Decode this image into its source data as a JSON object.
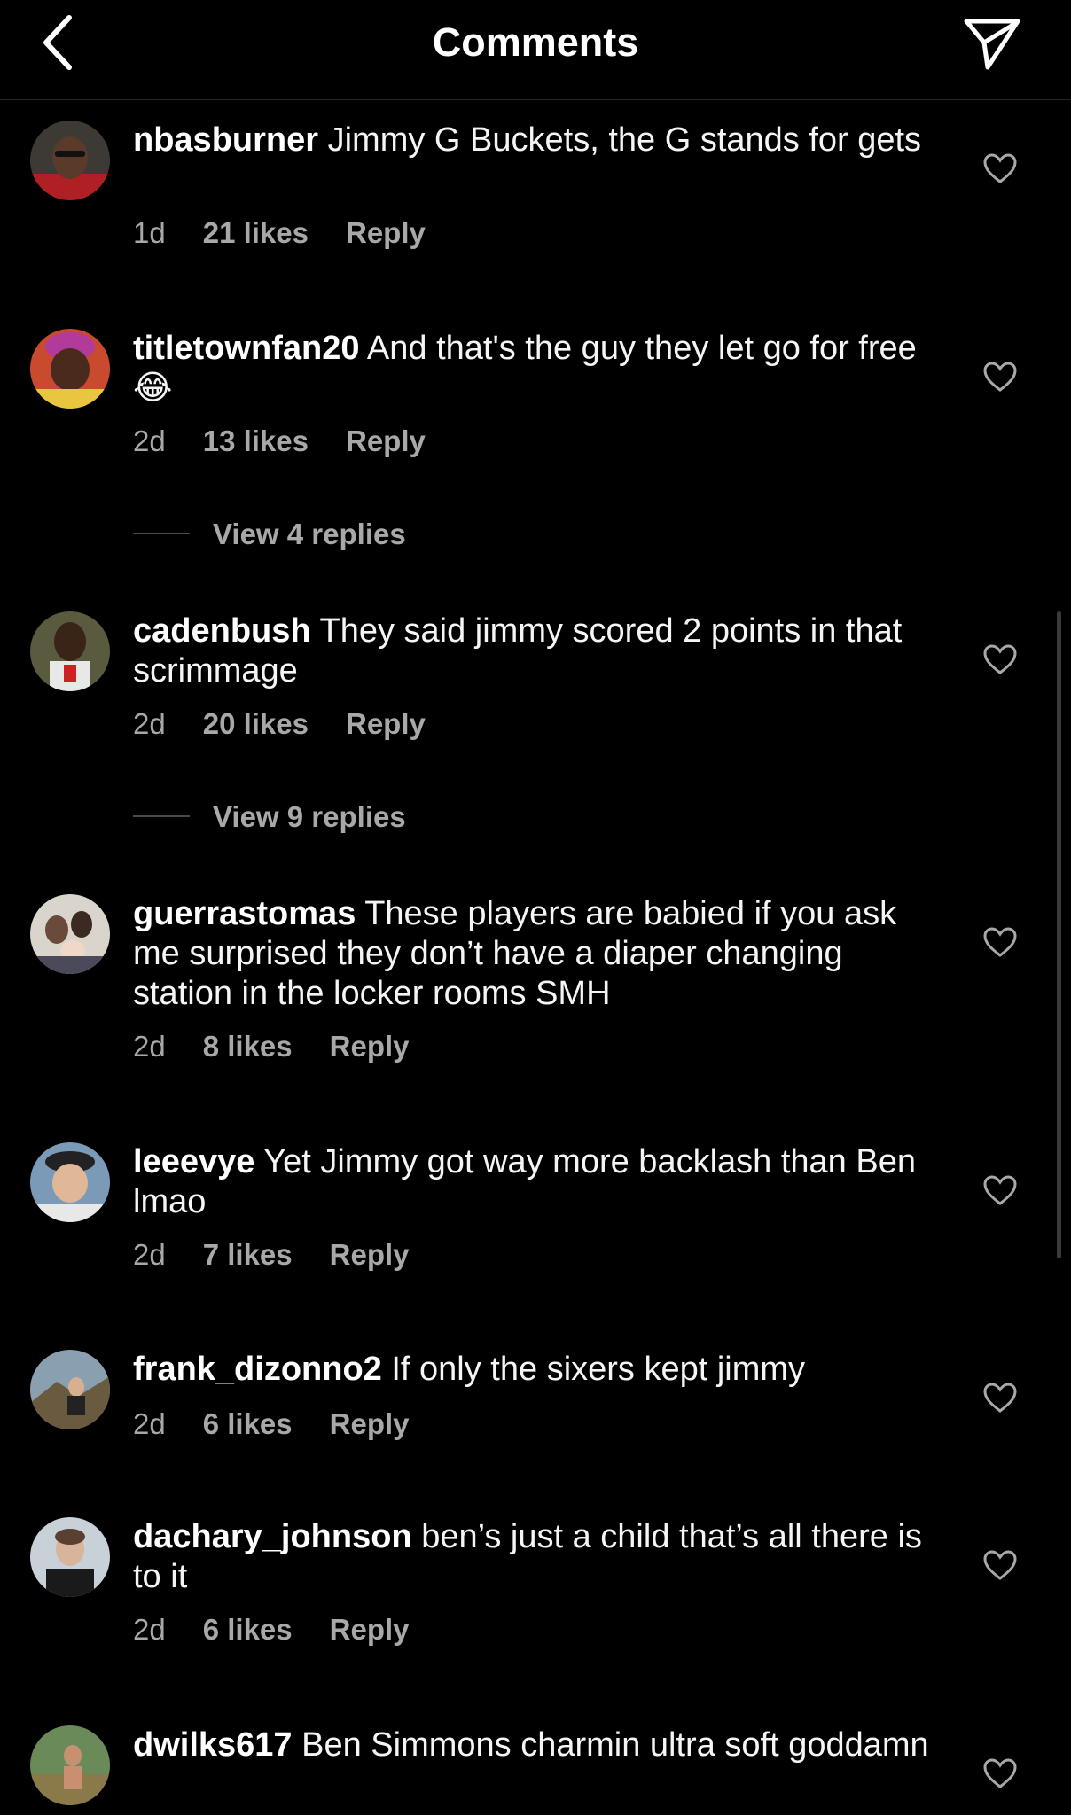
{
  "header": {
    "title": "Comments",
    "back_icon": "chevron-left-icon",
    "send_icon": "paper-plane-icon"
  },
  "comments": [
    {
      "username": "nbasburner",
      "text": " Jimmy G Buckets, the G stands for gets",
      "time": "1d",
      "likes": "21 likes",
      "reply": "Reply"
    },
    {
      "username": "titletownfan20",
      "text": " And that's the guy they let go for free 😂",
      "time": "2d",
      "likes": "13 likes",
      "reply": "Reply"
    },
    {
      "username": "cadenbush",
      "text": " They said jimmy scored 2 points in that scrimmage",
      "time": "2d",
      "likes": "20 likes",
      "reply": "Reply"
    },
    {
      "username": "guerrastomas",
      "text": " These players are babied if you ask me surprised they don’t have a diaper changing station in the locker rooms SMH",
      "time": "2d",
      "likes": "8 likes",
      "reply": "Reply"
    },
    {
      "username": "leeevye",
      "text": " Yet Jimmy got way more backlash than Ben lmao",
      "time": "2d",
      "likes": "7 likes",
      "reply": "Reply"
    },
    {
      "username": "frank_dizonno2",
      "text": " If only the sixers kept jimmy",
      "time": "2d",
      "likes": "6 likes",
      "reply": "Reply"
    },
    {
      "username": "dachary_johnson",
      "text": " ben’s just a child that’s all there is to it",
      "time": "2d",
      "likes": "6 likes",
      "reply": "Reply"
    },
    {
      "username": "dwilks617",
      "text": " Ben Simmons charmin ultra soft goddamn",
      "time": "",
      "likes": "",
      "reply": ""
    }
  ],
  "view_replies": [
    {
      "label": "View 4 replies"
    },
    {
      "label": "View 9 replies"
    }
  ],
  "colors": {
    "background": "#000000",
    "text": "#ffffff",
    "meta": "#a8a8a8",
    "divider": "#262626"
  }
}
